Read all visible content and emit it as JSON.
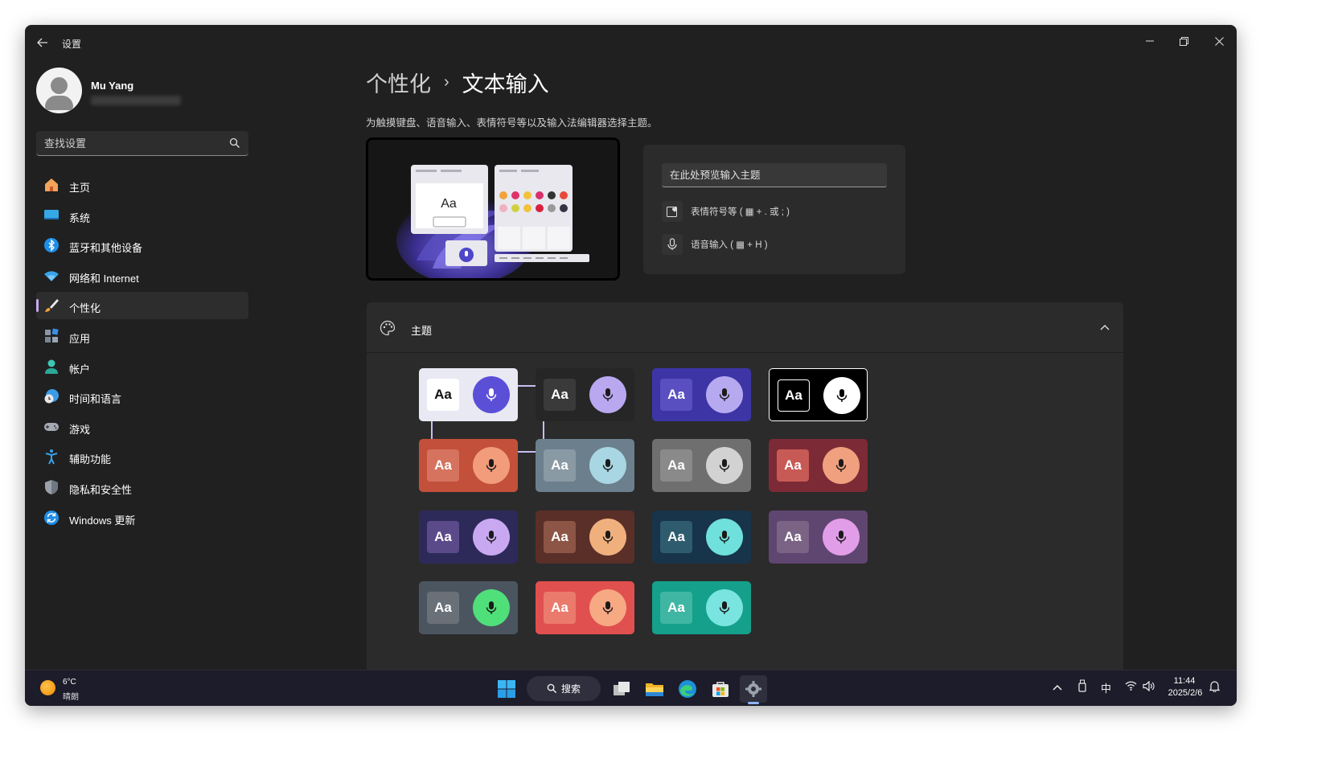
{
  "window": {
    "title": "设置",
    "back_icon": "back-arrow-icon",
    "controls": [
      "minimize-icon",
      "restore-icon",
      "close-icon"
    ]
  },
  "user": {
    "name": "Mu Yang"
  },
  "search": {
    "placeholder": "查找设置",
    "icon": "search-icon"
  },
  "sidebar": {
    "items": [
      {
        "label": "主页",
        "icon": "home-icon",
        "active": false
      },
      {
        "label": "系统",
        "icon": "system-icon",
        "active": false
      },
      {
        "label": "蓝牙和其他设备",
        "icon": "bluetooth-icon",
        "active": false
      },
      {
        "label": "网络和 Internet",
        "icon": "wifi-icon",
        "active": false
      },
      {
        "label": "个性化",
        "icon": "brush-icon",
        "active": true
      },
      {
        "label": "应用",
        "icon": "apps-icon",
        "active": false
      },
      {
        "label": "帐户",
        "icon": "account-icon",
        "active": false
      },
      {
        "label": "时间和语言",
        "icon": "time-language-icon",
        "active": false
      },
      {
        "label": "游戏",
        "icon": "gamepad-icon",
        "active": false
      },
      {
        "label": "辅助功能",
        "icon": "accessibility-icon",
        "active": false
      },
      {
        "label": "隐私和安全性",
        "icon": "shield-icon",
        "active": false
      },
      {
        "label": "Windows 更新",
        "icon": "update-icon",
        "active": false
      }
    ]
  },
  "main": {
    "breadcrumb_parent": "个性化",
    "breadcrumb_separator": "›",
    "breadcrumb_current": "文本输入",
    "subtitle": "为触摸键盘、语音输入、表情符号等以及输入法编辑器选择主题。",
    "preview": {
      "sample_text": "Aa",
      "input_placeholder": "在此处预览输入主题",
      "emoji_label": "表情符号等 ( ▦ + . 或 ; )",
      "voice_label": "语音输入 ( ▦ + H )"
    },
    "themes": {
      "title": "主题",
      "tile_text": "Aa",
      "selected_index": 0,
      "tiles": [
        {
          "bg": "#e9e9f3",
          "aa_bg": "#ffffff",
          "aa_fg": "#111111",
          "mic_bg": "#5b4fd8",
          "mic_fg": "#ffffff"
        },
        {
          "bg": "#262626",
          "aa_bg": "#3a3a3a",
          "aa_fg": "#ffffff",
          "mic_bg": "#b9a8ef",
          "mic_fg": "#1a1a1a"
        },
        {
          "bg": "#3d35a6",
          "aa_bg": "#5a4fc0",
          "aa_fg": "#ffffff",
          "mic_bg": "#b7a9f0",
          "mic_fg": "#1a1a1a"
        },
        {
          "bg": "#000000",
          "aa_bg": "#000000",
          "aa_fg": "#ffffff",
          "mic_bg": "#ffffff",
          "mic_fg": "#000000"
        },
        {
          "bg": "#c2503a",
          "aa_bg": "#d5735f",
          "aa_fg": "#ffffff",
          "mic_bg": "#f29c7c",
          "mic_fg": "#1a1a1a"
        },
        {
          "bg": "#6c7f8c",
          "aa_bg": "#8a9aa5",
          "aa_fg": "#ffffff",
          "mic_bg": "#a8d6e2",
          "mic_fg": "#1a1a1a"
        },
        {
          "bg": "#6f6f6f",
          "aa_bg": "#8a8a8a",
          "aa_fg": "#ffffff",
          "mic_bg": "#d2d2d2",
          "mic_fg": "#1a1a1a"
        },
        {
          "bg": "#7c2a35",
          "aa_bg": "#c85a55",
          "aa_fg": "#ffffff",
          "mic_bg": "#f0a07e",
          "mic_fg": "#1a1a1a"
        },
        {
          "bg": "#2d2a5a",
          "aa_bg": "#5b4a8a",
          "aa_fg": "#ffffff",
          "mic_bg": "#c9a8f2",
          "mic_fg": "#1a1a1a"
        },
        {
          "bg": "#5a2f28",
          "aa_bg": "#8c5545",
          "aa_fg": "#ffffff",
          "mic_bg": "#f0b07e",
          "mic_fg": "#1a1a1a"
        },
        {
          "bg": "#17344a",
          "aa_bg": "#2f5b6e",
          "aa_fg": "#ffffff",
          "mic_bg": "#6fe0dc",
          "mic_fg": "#1a1a1a"
        },
        {
          "bg": "#5f4670",
          "aa_bg": "#7a6385",
          "aa_fg": "#ffffff",
          "mic_bg": "#e29de8",
          "mic_fg": "#1a1a1a"
        },
        {
          "bg": "#4b5560",
          "aa_bg": "#6a7078",
          "aa_fg": "#ffffff",
          "mic_bg": "#4fe07a",
          "mic_fg": "#1a1a1a"
        },
        {
          "bg": "#e0504e",
          "aa_bg": "#ea7a6c",
          "aa_fg": "#ffffff",
          "mic_bg": "#f6a983",
          "mic_fg": "#1a1a1a"
        },
        {
          "bg": "#14a08a",
          "aa_bg": "#3fb6a3",
          "aa_fg": "#ffffff",
          "mic_bg": "#7ae4e0",
          "mic_fg": "#1a1a1a"
        }
      ]
    }
  },
  "taskbar": {
    "weather_temp": "6°C",
    "weather_desc": "晴朗",
    "search_label": "搜索",
    "ime": "中",
    "time": "11:44",
    "date": "2025/2/6"
  }
}
